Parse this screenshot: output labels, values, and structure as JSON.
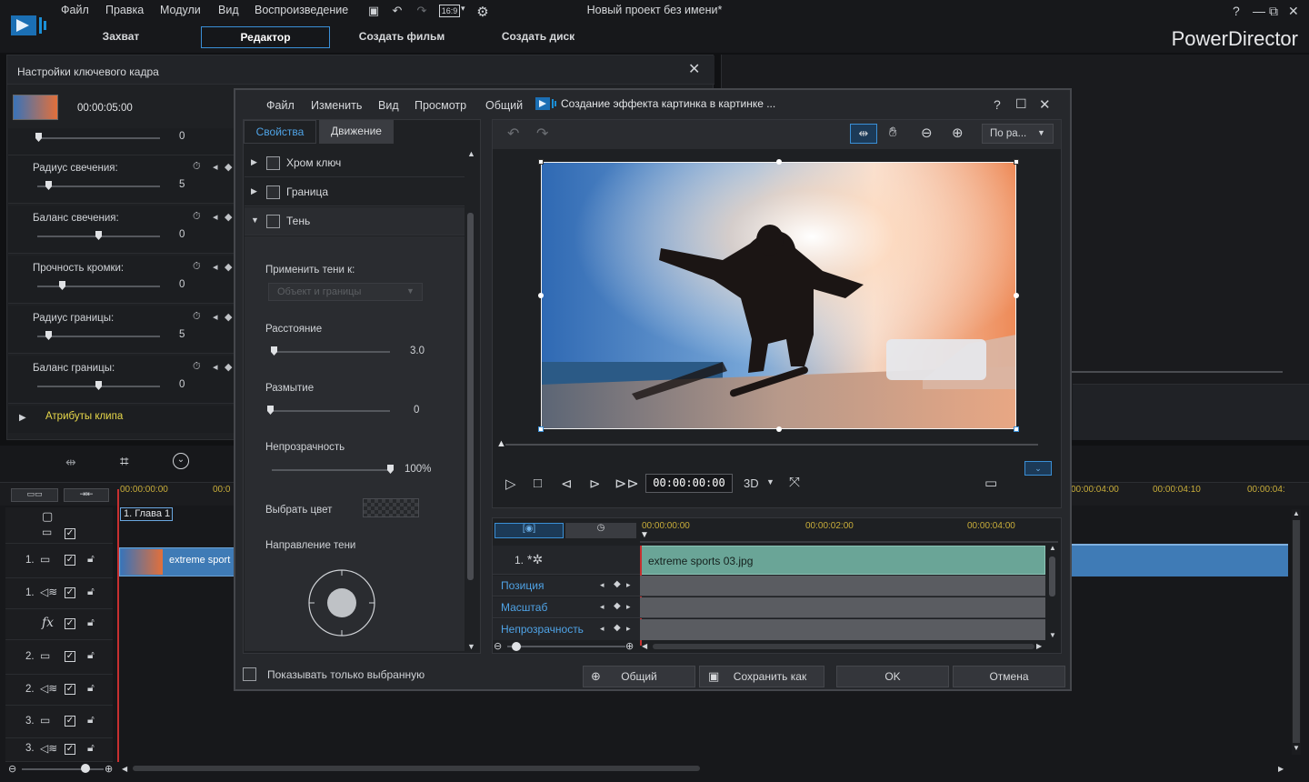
{
  "menu": [
    "Файл",
    "Правка",
    "Модули",
    "Вид",
    "Воспроизведение"
  ],
  "aspect": "16:9",
  "app_title": "Новый проект без имени*",
  "brand": "PowerDirector",
  "tabs": [
    "Захват",
    "Редактор",
    "Создать фильм",
    "Создать диск"
  ],
  "keyframe": {
    "title": "Настройки ключевого кадра",
    "time": "00:00:05:00",
    "first_value": "0",
    "rows": [
      {
        "label": "Радиус свечения:",
        "value": "5"
      },
      {
        "label": "Баланс свечения:",
        "value": "0"
      },
      {
        "label": "Прочность кромки:",
        "value": "0"
      },
      {
        "label": "Радиус границы:",
        "value": "5"
      },
      {
        "label": "Баланс границы:",
        "value": "0"
      }
    ],
    "clip_attrs": "Атрибуты клипа"
  },
  "timeline": {
    "time_start": "00:00:00:00",
    "time_partial": "00:0",
    "time_right": [
      "00:00:04:00",
      "00:00:04:10",
      "00:00:04:"
    ],
    "chapter": "1. Глава 1",
    "clip_label": "extreme sport",
    "track_nums": [
      "1.",
      "1.",
      "",
      "2.",
      "2.",
      "3.",
      "3."
    ]
  },
  "pip": {
    "menu": [
      "Файл",
      "Изменить",
      "Вид",
      "Просмотр",
      "Общий"
    ],
    "title": "Создание эффекта картинка в картинке ...",
    "tabs": [
      "Свойства",
      "Движение"
    ],
    "sections": [
      "Хром ключ",
      "Граница",
      "Тень"
    ],
    "apply_label": "Применить тени к:",
    "apply_select": "Объект и границы",
    "distance_label": "Расстояние",
    "distance_value": "3.0",
    "blur_label": "Размытие",
    "blur_value": "0",
    "opacity_label": "Непрозрачность",
    "opacity_value": "100%",
    "color_label": "Выбрать цвет",
    "direction_label": "Направление тени",
    "show_selected": "Показывать только выбранную",
    "fit_select": "По ра...",
    "timecode": "00:00:00:00",
    "mode_3d": "3D",
    "mini_times": [
      "00:00:00:00",
      "00:00:02:00",
      "00:00:04:00"
    ],
    "track_label": "1.",
    "clip_name": "extreme sports 03.jpg",
    "attrs": [
      "Позиция",
      "Масштаб",
      "Непрозрачность"
    ],
    "buttons": {
      "general": "Общий",
      "save_as": "Сохранить как",
      "ok": "OK",
      "cancel": "Отмена"
    }
  }
}
